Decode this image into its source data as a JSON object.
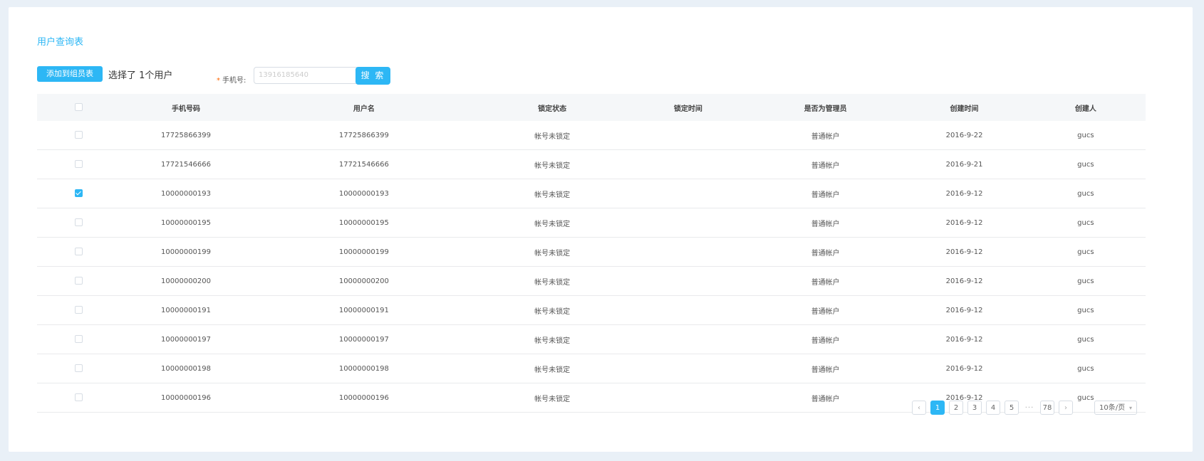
{
  "page": {
    "title": "用户查询表"
  },
  "toolbar": {
    "add_button_label": "添加到组员表",
    "selected_text": "选择了 1个用户",
    "phone_label": "手机号:",
    "phone_required_mark": "*",
    "phone_placeholder": "13916185640",
    "search_button_label": "搜 索"
  },
  "table": {
    "columns": [
      "",
      "手机号码",
      "用户名",
      "锁定状态",
      "锁定时间",
      "是否为管理员",
      "创建时间",
      "创建人"
    ],
    "rows": [
      {
        "checked": false,
        "phone": "17725866399",
        "username": "17725866399",
        "lock_status": "帐号未锁定",
        "lock_time": "",
        "admin": "普通帐户",
        "created": "2016-9-22",
        "creator": "gucs"
      },
      {
        "checked": false,
        "phone": "17721546666",
        "username": "17721546666",
        "lock_status": "帐号未锁定",
        "lock_time": "",
        "admin": "普通帐户",
        "created": "2016-9-21",
        "creator": "gucs"
      },
      {
        "checked": true,
        "phone": "10000000193",
        "username": "10000000193",
        "lock_status": "帐号未锁定",
        "lock_time": "",
        "admin": "普通帐户",
        "created": "2016-9-12",
        "creator": "gucs"
      },
      {
        "checked": false,
        "phone": "10000000195",
        "username": "10000000195",
        "lock_status": "帐号未锁定",
        "lock_time": "",
        "admin": "普通帐户",
        "created": "2016-9-12",
        "creator": "gucs"
      },
      {
        "checked": false,
        "phone": "10000000199",
        "username": "10000000199",
        "lock_status": "帐号未锁定",
        "lock_time": "",
        "admin": "普通帐户",
        "created": "2016-9-12",
        "creator": "gucs"
      },
      {
        "checked": false,
        "phone": "10000000200",
        "username": "10000000200",
        "lock_status": "帐号未锁定",
        "lock_time": "",
        "admin": "普通帐户",
        "created": "2016-9-12",
        "creator": "gucs"
      },
      {
        "checked": false,
        "phone": "10000000191",
        "username": "10000000191",
        "lock_status": "帐号未锁定",
        "lock_time": "",
        "admin": "普通帐户",
        "created": "2016-9-12",
        "creator": "gucs"
      },
      {
        "checked": false,
        "phone": "10000000197",
        "username": "10000000197",
        "lock_status": "帐号未锁定",
        "lock_time": "",
        "admin": "普通帐户",
        "created": "2016-9-12",
        "creator": "gucs"
      },
      {
        "checked": false,
        "phone": "10000000198",
        "username": "10000000198",
        "lock_status": "帐号未锁定",
        "lock_time": "",
        "admin": "普通帐户",
        "created": "2016-9-12",
        "creator": "gucs"
      },
      {
        "checked": false,
        "phone": "10000000196",
        "username": "10000000196",
        "lock_status": "帐号未锁定",
        "lock_time": "",
        "admin": "普通帐户",
        "created": "2016-9-12",
        "creator": "gucs"
      }
    ]
  },
  "pagination": {
    "prev_icon": "chevron-left-icon",
    "next_icon": "chevron-right-icon",
    "pages": [
      "1",
      "2",
      "3",
      "4",
      "5"
    ],
    "current_page": "1",
    "ellipsis": "···",
    "last_page": "78",
    "page_size_label": "10条/页"
  },
  "colors": {
    "accent": "#2db7f5",
    "background": "#e9f0f7",
    "header_bg": "#f5f7f9"
  }
}
